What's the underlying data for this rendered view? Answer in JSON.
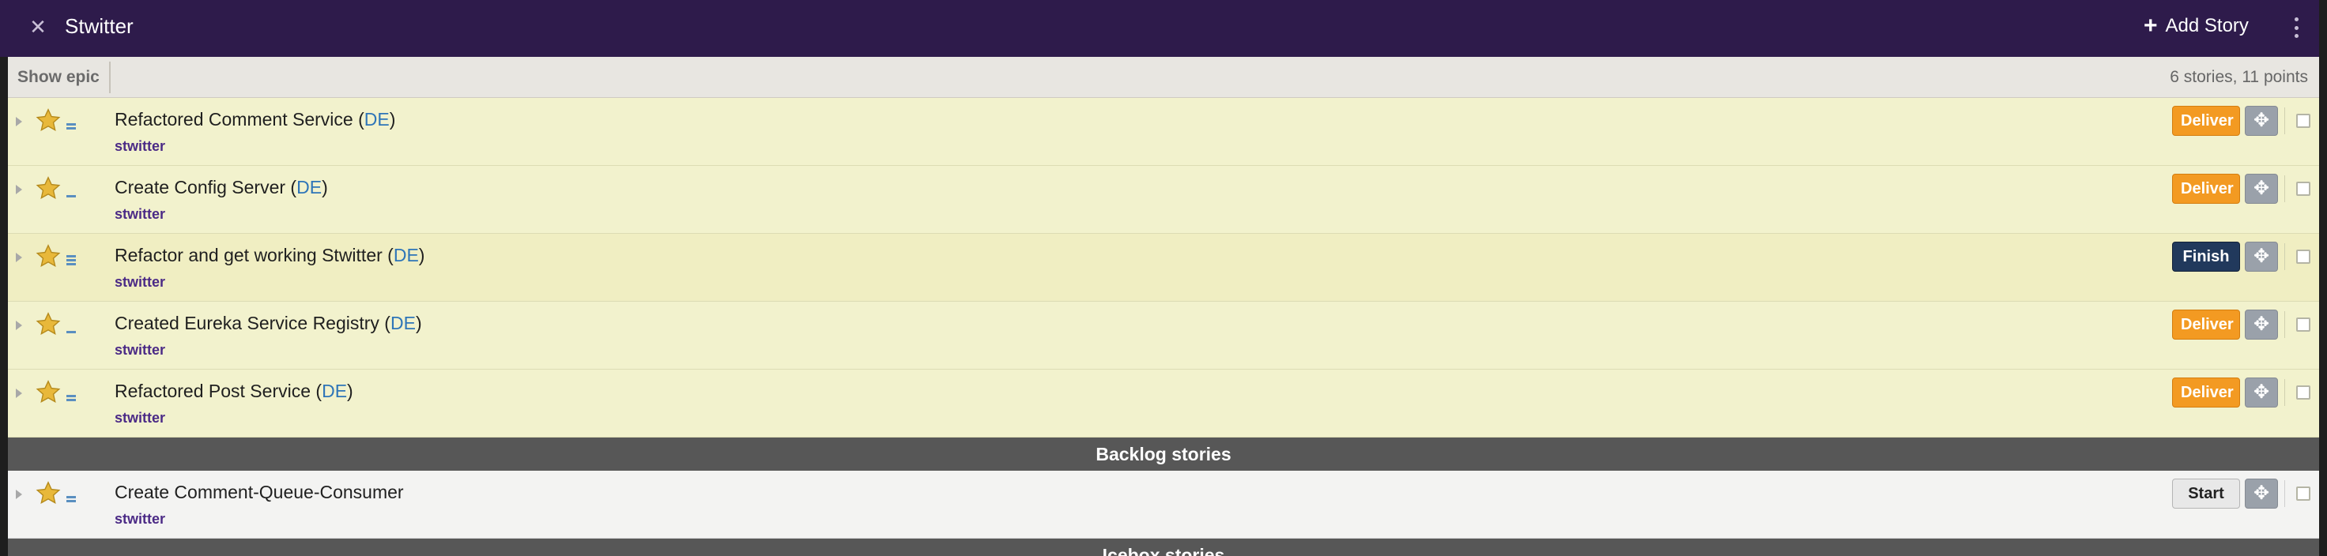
{
  "header": {
    "title": "Stwitter",
    "add_story_label": "Add Story"
  },
  "toolbar": {
    "show_epic_label": "Show epic",
    "summary": "6 stories, 11 points"
  },
  "stories": [
    {
      "title": "Refactored Comment Service",
      "owner": "DE",
      "label": "stwitter",
      "action": "Deliver",
      "state": "finished",
      "estimate": 2
    },
    {
      "title": "Create Config Server",
      "owner": "DE",
      "label": "stwitter",
      "action": "Deliver",
      "state": "finished",
      "estimate": 1
    },
    {
      "title": "Refactor and get working Stwitter",
      "owner": "DE",
      "label": "stwitter",
      "action": "Finish",
      "state": "started",
      "estimate": 3
    },
    {
      "title": "Created Eureka Service Registry",
      "owner": "DE",
      "label": "stwitter",
      "action": "Deliver",
      "state": "finished",
      "estimate": 1
    },
    {
      "title": "Refactored Post Service",
      "owner": "DE",
      "label": "stwitter",
      "action": "Deliver",
      "state": "finished",
      "estimate": 2
    }
  ],
  "sections": {
    "backlog_title": "Backlog stories",
    "icebox_title": "Icebox stories"
  },
  "backlog_stories": [
    {
      "title": "Create Comment-Queue-Consumer",
      "label": "stwitter",
      "action": "Start",
      "state": "unstarted",
      "estimate": 2
    }
  ],
  "colors": {
    "header_bg": "#2e1b4b",
    "deliver": "#f39a22",
    "finish": "#21395c",
    "label": "#4b2a86",
    "owner_link": "#2e75b8"
  },
  "icons": {
    "close": "close-icon",
    "add": "plus-icon",
    "more": "kebab-icon",
    "feature": "star-icon",
    "move": "move-icon"
  }
}
